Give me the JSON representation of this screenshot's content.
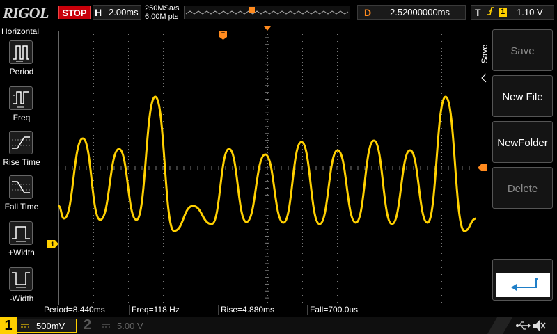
{
  "brand": "RIGOL",
  "run_state": "STOP",
  "horizontal": {
    "label": "H",
    "timebase": "2.00ms",
    "sample_rate": "250MSa/s",
    "memory_depth": "6.00M pts"
  },
  "delay": {
    "label": "D",
    "value": "2.52000000ms"
  },
  "trigger": {
    "label": "T",
    "edge_icon": "rising-edge-icon",
    "source_channel": "1",
    "level": "1.10 V"
  },
  "left_menu": {
    "title": "Horizontal",
    "items": [
      {
        "label": "Period",
        "icon": "period-icon"
      },
      {
        "label": "Freq",
        "icon": "frequency-icon"
      },
      {
        "label": "Rise Time",
        "icon": "rise-time-icon"
      },
      {
        "label": "Fall Time",
        "icon": "fall-time-icon"
      },
      {
        "label": "+Width",
        "icon": "positive-width-icon"
      },
      {
        "label": "-Width",
        "icon": "negative-width-icon"
      }
    ]
  },
  "right_menu": {
    "title": "Save",
    "buttons": [
      {
        "label": "Save",
        "enabled": false
      },
      {
        "label": "New File",
        "enabled": true
      },
      {
        "label": "NewFolder",
        "enabled": true
      },
      {
        "label": "Delete",
        "enabled": false
      }
    ],
    "enter_icon": "enter-icon"
  },
  "measurements": {
    "period": "Period=8.440ms",
    "freq": "Freq=118 Hz",
    "rise": "Rise=4.880ms",
    "fall": "Fall=700.0us"
  },
  "channel1": {
    "number": "1",
    "scale": "500mV",
    "color": "#ffd000"
  },
  "channel2": {
    "number": "2",
    "scale": "5.00 V"
  },
  "status_icons": [
    "usb-icon",
    "mute-icon"
  ],
  "colors": {
    "trace": "#ffd000",
    "trigger_marker": "#ff8a1e",
    "stop": "#c8000a"
  }
}
